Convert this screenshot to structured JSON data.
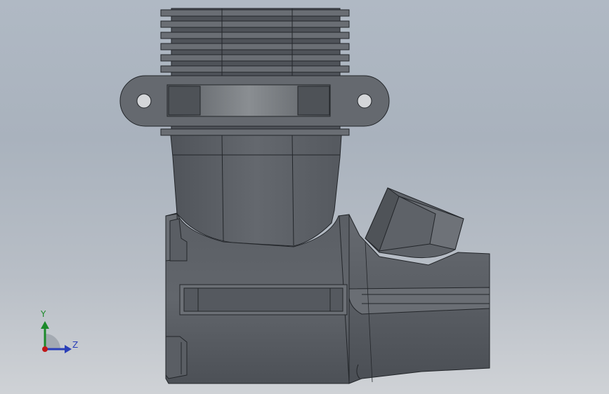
{
  "viewport": {
    "background_top": "#b0b9c4",
    "background_bottom": "#cfd2d6",
    "model_fill": "#5e6268",
    "edge_color": "#23262a"
  },
  "triad": {
    "y_label": "Y",
    "z_label": "Z",
    "y_color": "#1c8a2a",
    "z_color": "#2a3fb8",
    "origin_color": "#c01818"
  }
}
